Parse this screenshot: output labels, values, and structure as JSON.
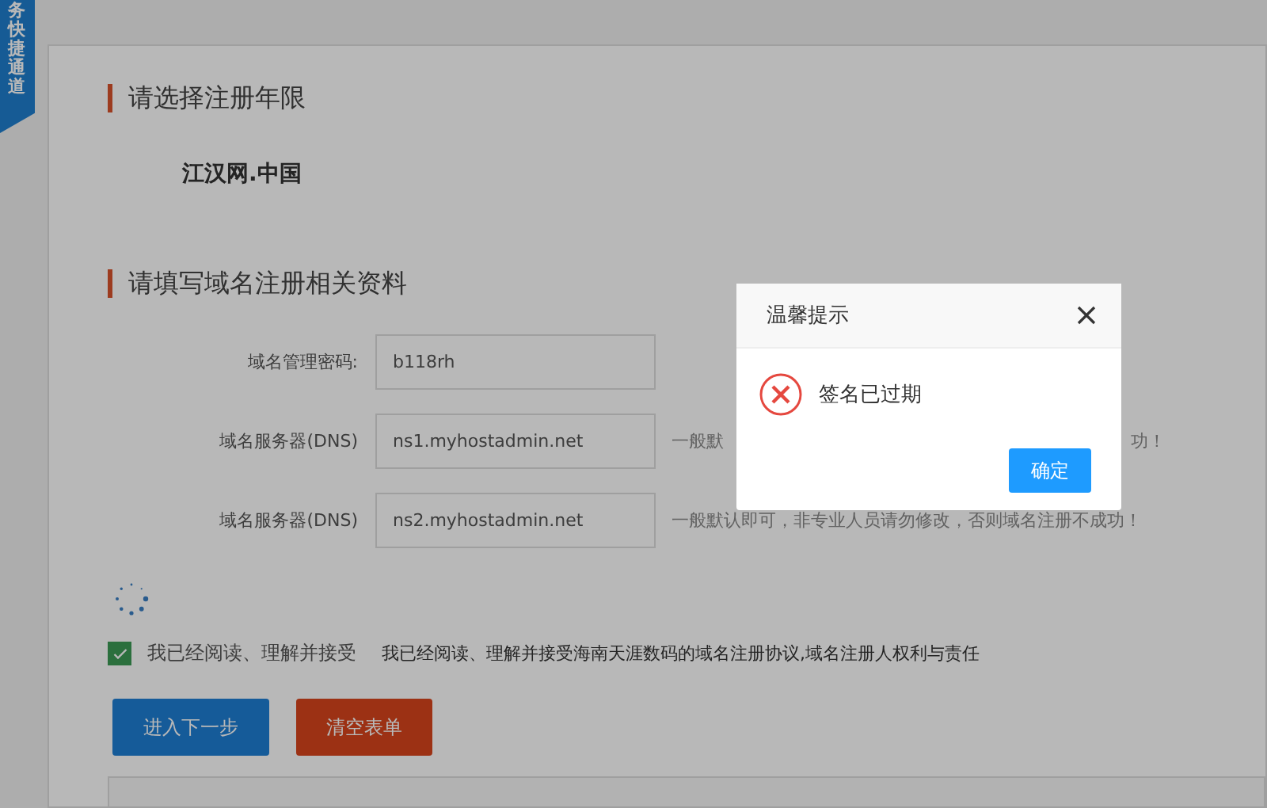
{
  "side_tab": {
    "label": "务快捷通道"
  },
  "sections": [
    {
      "title": "请选择注册年限",
      "domain": "江汉网.中国"
    },
    {
      "title": "请填写域名注册相关资料",
      "fields": [
        {
          "label": "域名管理密码:",
          "value": "b118rh"
        },
        {
          "label": "域名服务器(DNS)",
          "value": "ns1.myhostadmin.net",
          "hint_parts": [
            "一般默",
            "功！"
          ]
        },
        {
          "label": "域名服务器(DNS)",
          "value": "ns2.myhostadmin.net",
          "hint_parts": [
            "一般默认即可，非专业人员请勿修改，否则域名注册不成功！"
          ]
        }
      ]
    }
  ],
  "agreement": {
    "checked": true,
    "label": "我已经阅读、理解并接受",
    "text": "我已经阅读、理解并接受海南天涯数码的域名注册协议,域名注册人权利与责任"
  },
  "buttons": [
    {
      "label": "进入下一步",
      "kind": "primary"
    },
    {
      "label": "清空表单",
      "kind": "danger"
    }
  ],
  "dialog": {
    "title": "温馨提示",
    "message": "签名已过期",
    "ok": "确定"
  }
}
